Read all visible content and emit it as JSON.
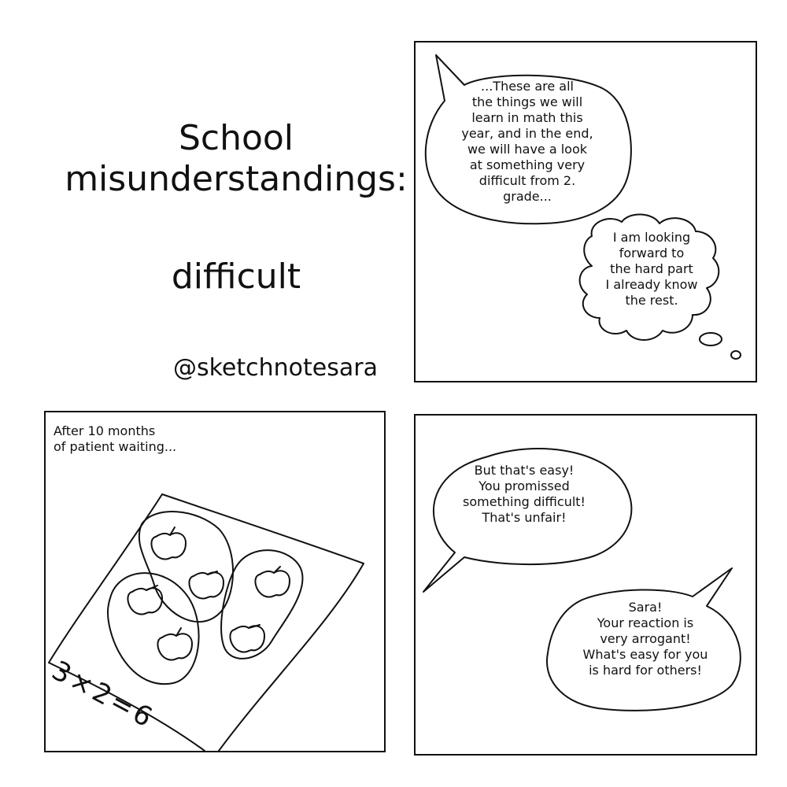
{
  "title": {
    "line1": "School\nmisunderstandings:",
    "line2": "difficult"
  },
  "credit": "@sketchnotesara",
  "panels": {
    "first": {
      "speech": "...These are all\nthe things we will\nlearn in math this\nyear, and in the end,\nwe will have a look\nat something very\ndifficult from 2.\ngrade...",
      "thought": "I am looking\nforward to\nthe hard part\nI already know\nthe rest."
    },
    "second": {
      "caption": "After 10 months\nof patient waiting...",
      "equation": "3×2=6"
    },
    "third": {
      "speech_child": "But that's easy!\nYou promissed\nsomething difficult!\nThat's unfair!",
      "speech_teacher": "Sara!\nYour reaction is\nvery arrogant!\nWhat's easy for you\nis hard for others!"
    }
  },
  "colors": {
    "ink": "#111111",
    "paper": "#ffffff"
  },
  "icons": [
    "apple-icon"
  ]
}
